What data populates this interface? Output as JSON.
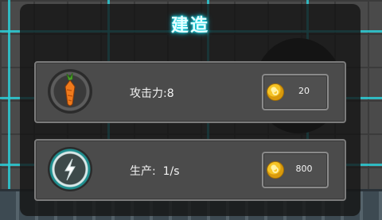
{
  "dialog": {
    "title": "建造"
  },
  "items": [
    {
      "icon": "carrot-attack-icon",
      "stat_label": "攻击力:8",
      "cost": "20",
      "currency_icon": "gold-coin-icon"
    },
    {
      "icon": "lightning-power-icon",
      "stat_label": "生产:  1/s",
      "cost": "800",
      "currency_icon": "gold-coin-icon"
    }
  ],
  "colors": {
    "title_glow": "#1ee0ee",
    "panel": "#4b4b4b",
    "coin": "#f6c425"
  }
}
